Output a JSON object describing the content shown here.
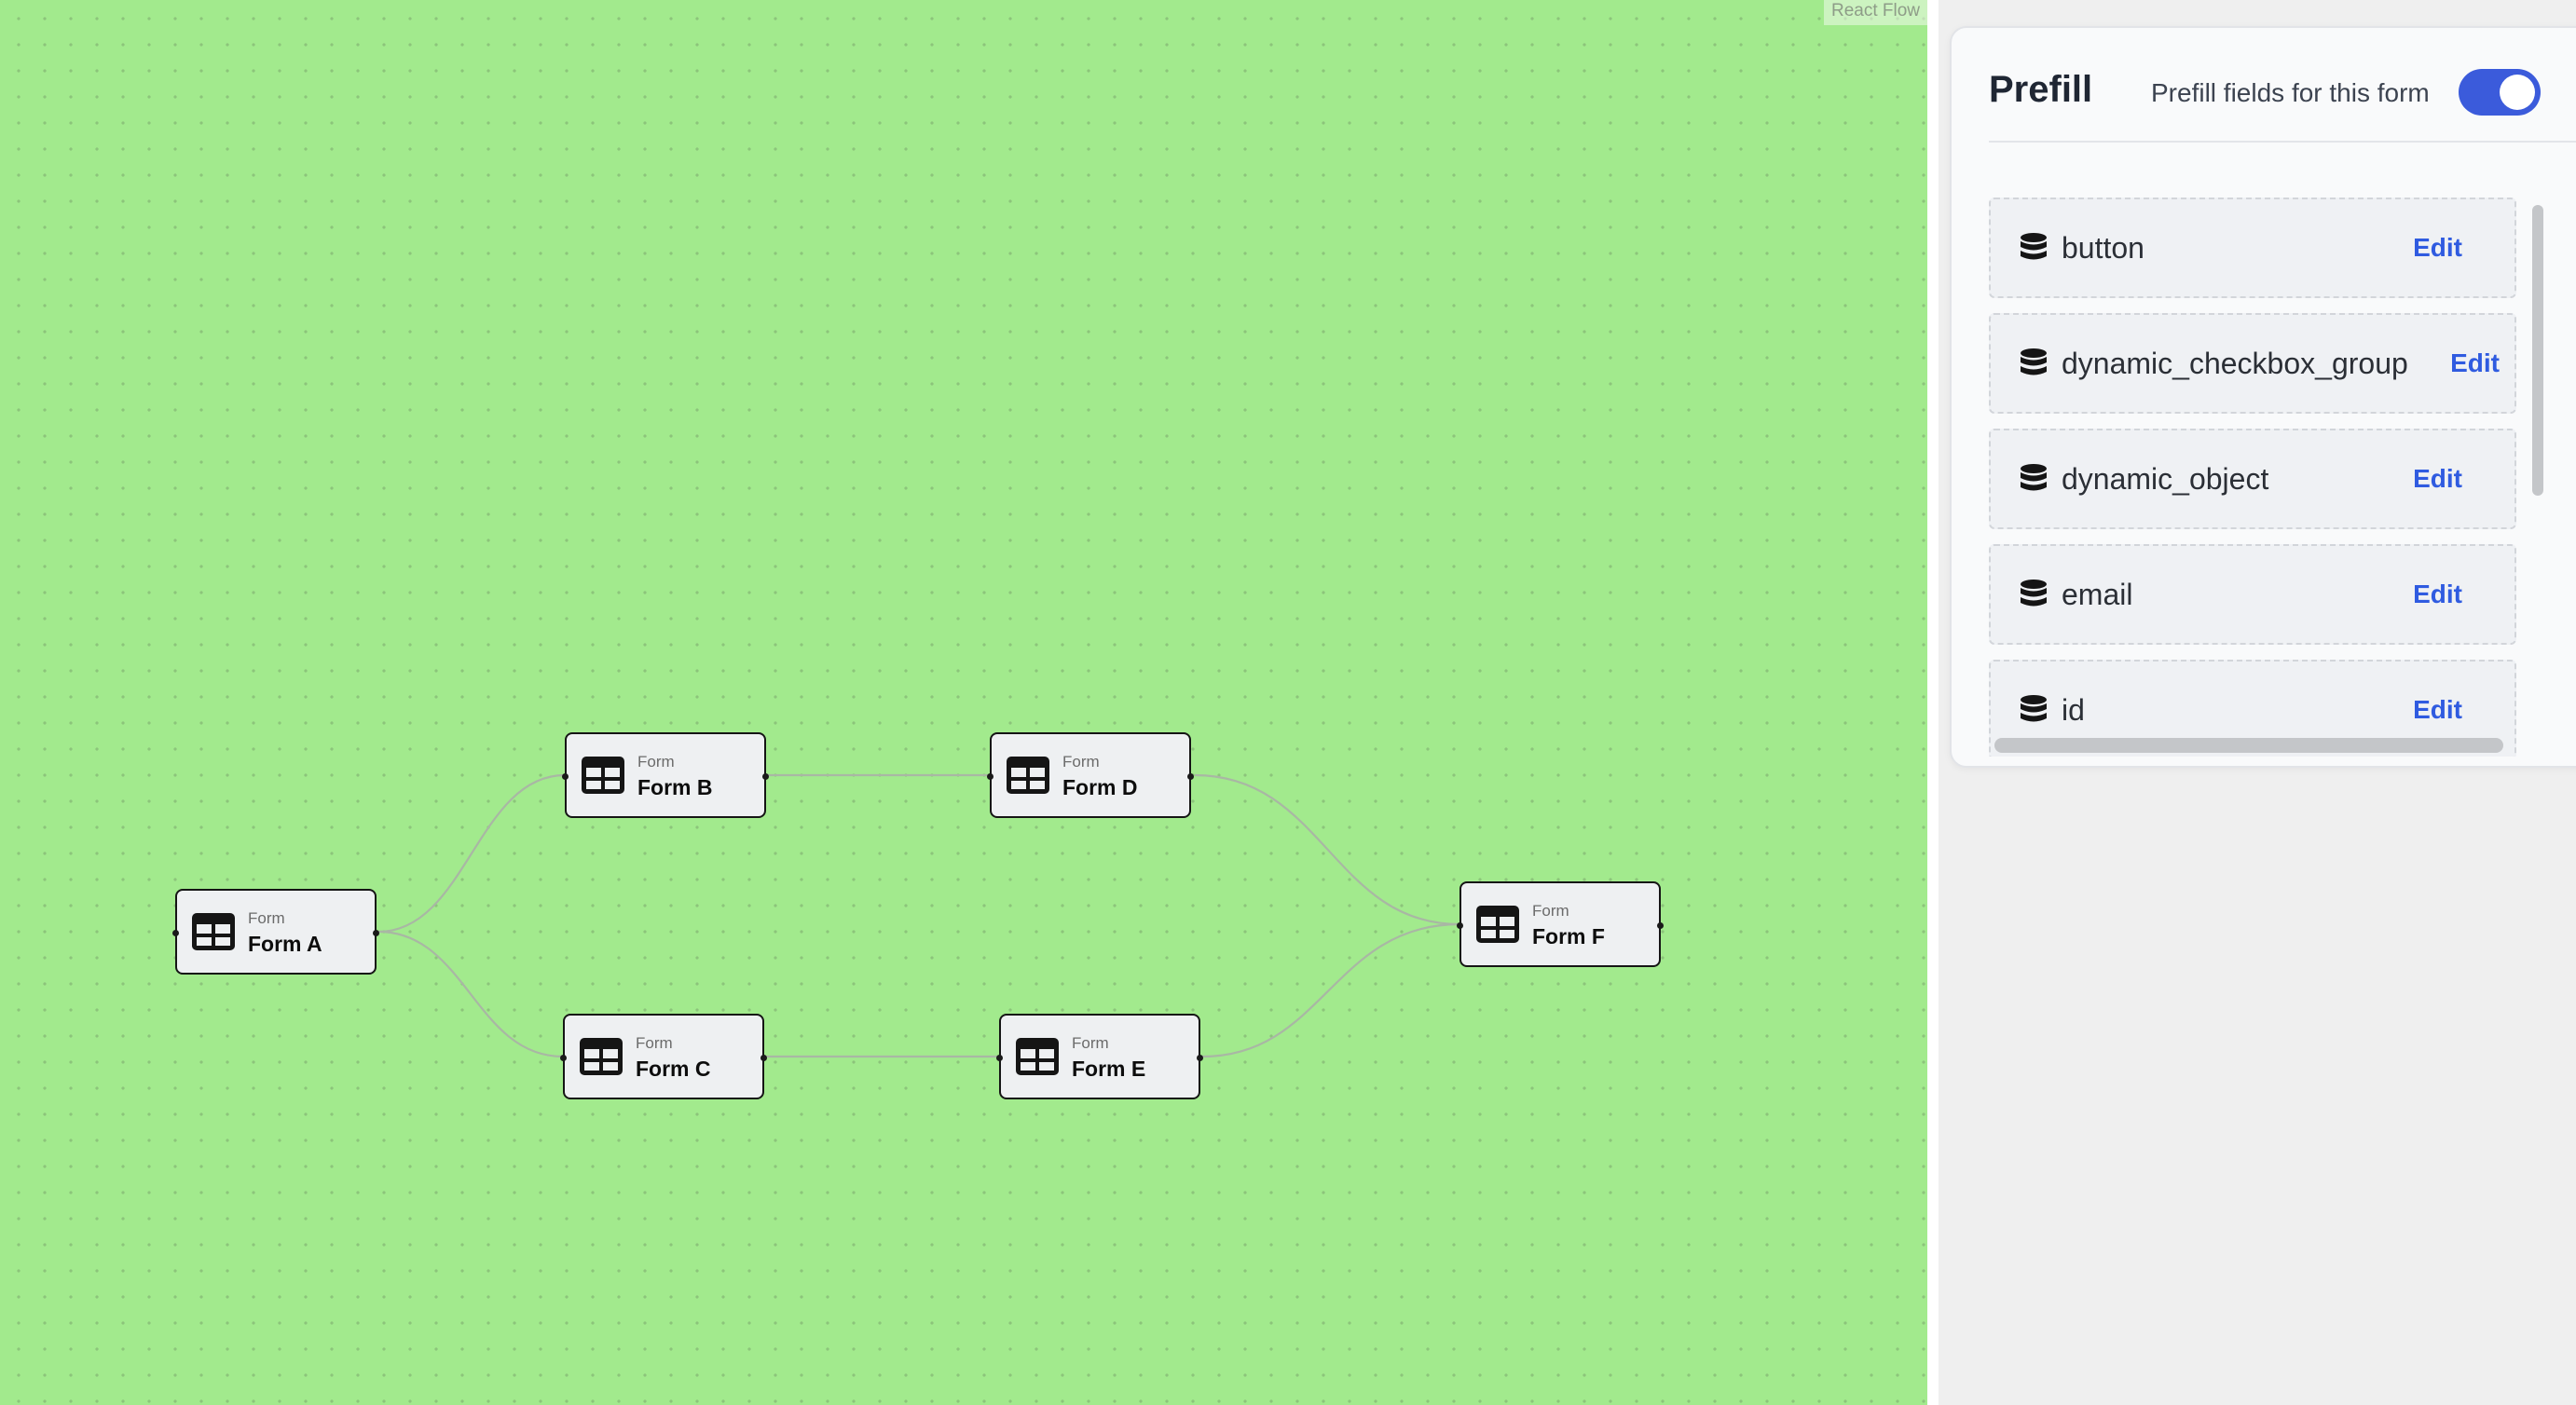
{
  "canvas": {
    "background_color": "#a2ea8d",
    "attribution": "React Flow",
    "nodes": [
      {
        "id": "a",
        "type_label": "Form",
        "name": "Form A",
        "icon": "table-icon"
      },
      {
        "id": "b",
        "type_label": "Form",
        "name": "Form B",
        "icon": "table-icon"
      },
      {
        "id": "c",
        "type_label": "Form",
        "name": "Form C",
        "icon": "table-icon"
      },
      {
        "id": "d",
        "type_label": "Form",
        "name": "Form D",
        "icon": "table-icon"
      },
      {
        "id": "e",
        "type_label": "Form",
        "name": "Form E",
        "icon": "table-icon"
      },
      {
        "id": "f",
        "type_label": "Form",
        "name": "Form F",
        "icon": "table-icon"
      }
    ],
    "edges": [
      {
        "from": "Form A",
        "to": "Form B"
      },
      {
        "from": "Form A",
        "to": "Form C"
      },
      {
        "from": "Form B",
        "to": "Form D"
      },
      {
        "from": "Form C",
        "to": "Form E"
      },
      {
        "from": "Form D",
        "to": "Form F"
      },
      {
        "from": "Form E",
        "to": "Form F"
      }
    ]
  },
  "prefill": {
    "title": "Prefill",
    "toggle_label": "Prefill fields for this form",
    "toggle_on": true,
    "accent_color": "#3b5bdb",
    "fields": [
      {
        "label": "button",
        "action": "Edit",
        "icon": "database-icon"
      },
      {
        "label": "dynamic_checkbox_group",
        "action": "Edit",
        "icon": "database-icon"
      },
      {
        "label": "dynamic_object",
        "action": "Edit",
        "icon": "database-icon"
      },
      {
        "label": "email",
        "action": "Edit",
        "icon": "database-icon"
      },
      {
        "label": "id",
        "action": "Edit",
        "icon": "database-icon"
      }
    ]
  }
}
